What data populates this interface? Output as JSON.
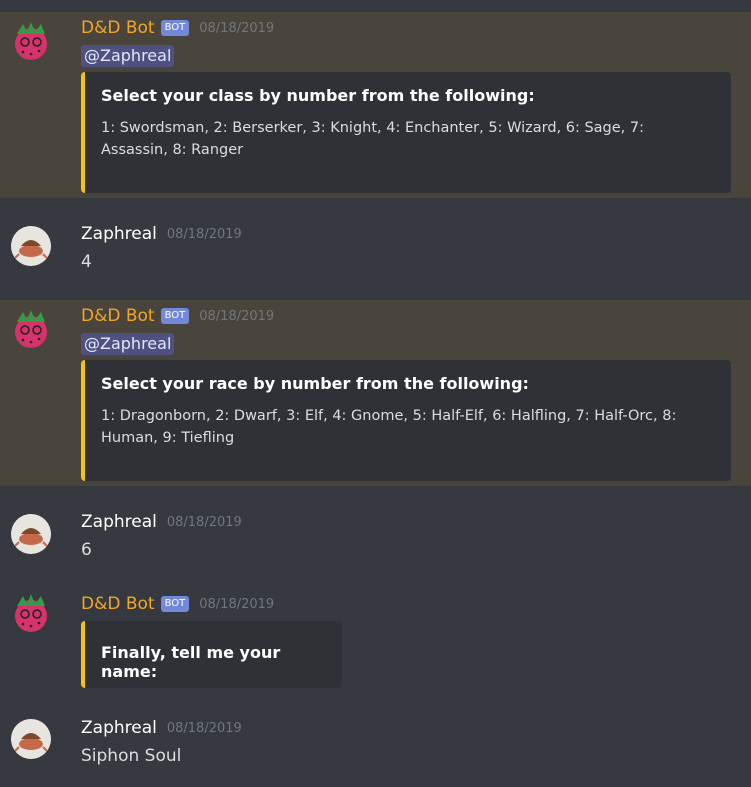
{
  "messages": [
    {
      "author": "D&D Bot",
      "badge": "BOT",
      "time": "08/18/2019",
      "mention": "@Zaphreal",
      "embed_title": "Select your class by number from the following:",
      "embed_desc": "1: Swordsman, 2: Berserker, 3: Knight, 4: Enchanter, 5: Wizard, 6: Sage, 7: Assassin, 8: Ranger"
    },
    {
      "author": "Zaphreal",
      "time": "08/18/2019",
      "text": "4"
    },
    {
      "author": "D&D Bot",
      "badge": "BOT",
      "time": "08/18/2019",
      "mention": "@Zaphreal",
      "embed_title": "Select your race by number from the following:",
      "embed_desc": "1: Dragonborn, 2: Dwarf, 3: Elf, 4: Gnome, 5: Half-Elf, 6: Halfling, 7: Half-Orc, 8: Human, 9: Tiefling"
    },
    {
      "author": "Zaphreal",
      "time": "08/18/2019",
      "text": "6"
    },
    {
      "author": "D&D Bot",
      "badge": "BOT",
      "time": "08/18/2019",
      "embed_title": "Finally, tell me your name:"
    },
    {
      "author": "Zaphreal",
      "time": "08/18/2019",
      "text": "Siphon Soul"
    }
  ]
}
